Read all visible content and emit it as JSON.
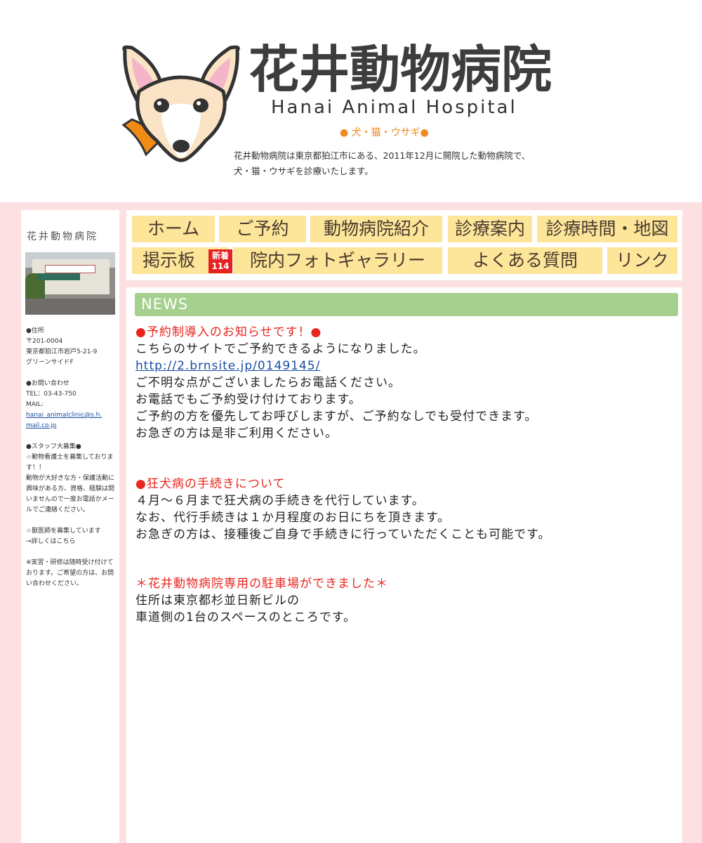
{
  "header": {
    "title": "花井動物病院",
    "subtitle": "Hanai  Animal  Hospital",
    "species": "● 犬・猫・ウサギ●",
    "intro_line1": "花井動物病院は東京都狛江市にある、2011年12月に開院した動物病院で、",
    "intro_line2": "犬・猫・ウサギを診療いたします。"
  },
  "nav": {
    "home": "ホーム",
    "reservation": "ご予約",
    "about": "動物病院紹介",
    "services": "診療案内",
    "hours_map": "診療時間・地図",
    "board": "掲示板",
    "new_label": "新着",
    "new_count": "114",
    "gallery": "院内フォトギャラリー",
    "faq": "よくある質問",
    "links": "リンク"
  },
  "sidebar": {
    "title": "花井動物病院",
    "address_heading": "●住所",
    "postal": "〒201-0004",
    "address1": "東京都狛江市岩戸5-21-9",
    "address2": "グリーンサイドF",
    "contact_heading": "●お問い合わせ",
    "tel": "TEL：03-43-750",
    "mail_label": "MAIL:",
    "mail_1": "hanai_animalclinic@s.h.",
    "mail_2": "mail.co.jp",
    "staff_heading": "●スタッフ大募集●",
    "staff_1": "☆動物看護士を募集しております！！",
    "staff_2": "動物が大好きな方・保護活動に興味がある方、資格、経験は問いませんので一度お電話かメールでご連絡ください。",
    "vet_1": "☆獣医師を募集しています",
    "vet_2": "→詳しくはこちら",
    "intern": "※実習・研修は随時受け付けております。ご希望の方は、お問い合わせください。"
  },
  "news": {
    "heading": "NEWS",
    "item1_title": "●予約制導入のお知らせです！●",
    "item1_l1": "こちらのサイトでご予約できるようになりました。",
    "item1_link": "http://2.brnsite.jp/0149145/",
    "item1_l2": "ご不明な点がございましたらお電話ください。",
    "item1_l3": "お電話でもご予約受け付けております。",
    "item1_l4": "ご予約の方を優先してお呼びしますが、ご予約なしでも受付できます。",
    "item1_l5": "お急ぎの方は是非ご利用ください。",
    "item2_title": "●狂犬病の手続きについて",
    "item2_l1": "４月〜６月まで狂犬病の手続きを代行しています。",
    "item2_l2": "なお、代行手続きは１か月程度のお日にちを頂きます。",
    "item2_l3": "お急ぎの方は、接種後ご自身で手続きに行っていただくことも可能です。",
    "item3_title": "＊花井動物病院専用の駐車場ができました＊",
    "item3_l1": "住所は東京都杉並日新ビルの",
    "item3_l2": "車道側の1台のスペースのところです。"
  }
}
